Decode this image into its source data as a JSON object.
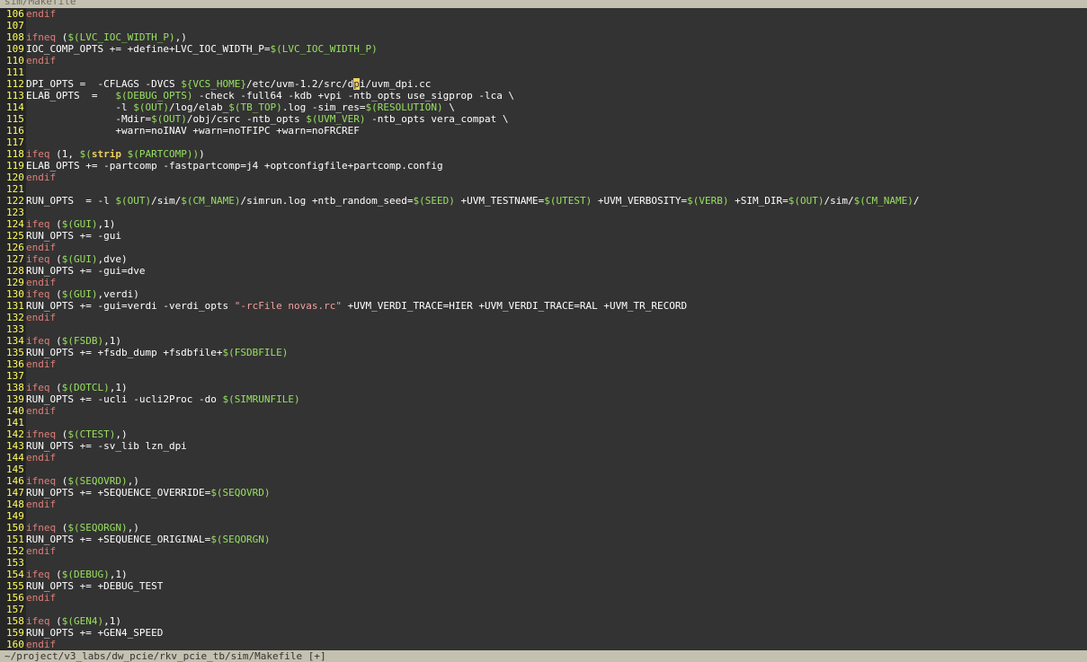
{
  "tab": {
    "label": "sim/Makefile"
  },
  "status": {
    "path": "~/project/v3_labs/dw_pcie/rkv_pcie_tb/sim/Makefile [+]"
  },
  "colors": {
    "background": "#333333",
    "line_number": "#ffff60",
    "keyword": "#e07e78",
    "variable": "#98e060",
    "string": "#f0a0a0",
    "statusline": "#c5c1b0"
  },
  "lines": [
    {
      "n": "106",
      "tokens": [
        {
          "t": "endif",
          "k": "kw"
        }
      ]
    },
    {
      "n": "107",
      "tokens": []
    },
    {
      "n": "108",
      "tokens": [
        {
          "t": "ifneq",
          "k": "kw"
        },
        {
          "t": " (",
          "k": "plain"
        },
        {
          "t": "$(LVC_IOC_WIDTH_P)",
          "k": "var"
        },
        {
          "t": ",)",
          "k": "plain"
        }
      ]
    },
    {
      "n": "109",
      "tokens": [
        {
          "t": "IOC_COMP_OPTS += +define+LVC_IOC_WIDTH_P=",
          "k": "plain"
        },
        {
          "t": "$(LVC_IOC_WIDTH_P)",
          "k": "var"
        }
      ]
    },
    {
      "n": "110",
      "tokens": [
        {
          "t": "endif",
          "k": "kw"
        }
      ]
    },
    {
      "n": "111",
      "tokens": []
    },
    {
      "n": "112",
      "tokens": [
        {
          "t": "DPI_OPTS =  -CFLAGS -DVCS ",
          "k": "plain"
        },
        {
          "t": "${VCS_HOME}",
          "k": "var"
        },
        {
          "t": "/etc/uvm-1.2/src/d",
          "k": "plain"
        },
        {
          "t": "p",
          "k": "cursor"
        },
        {
          "t": "i/uvm_dpi.cc",
          "k": "plain"
        }
      ]
    },
    {
      "n": "113",
      "tokens": [
        {
          "t": "ELAB_OPTS  =   ",
          "k": "plain"
        },
        {
          "t": "$(DEBUG_OPTS)",
          "k": "var"
        },
        {
          "t": " -check -full64 -kdb +vpi -ntb_opts use_sigprop -lca \\",
          "k": "plain"
        }
      ]
    },
    {
      "n": "114",
      "tokens": [
        {
          "t": "               -l ",
          "k": "plain"
        },
        {
          "t": "$(OUT)",
          "k": "var"
        },
        {
          "t": "/log/elab_",
          "k": "plain"
        },
        {
          "t": "$(TB_TOP)",
          "k": "var"
        },
        {
          "t": ".log -sim_res=",
          "k": "plain"
        },
        {
          "t": "$(RESOLUTION)",
          "k": "var"
        },
        {
          "t": " \\",
          "k": "plain"
        }
      ]
    },
    {
      "n": "115",
      "tokens": [
        {
          "t": "               -Mdir=",
          "k": "plain"
        },
        {
          "t": "$(OUT)",
          "k": "var"
        },
        {
          "t": "/obj/csrc -ntb_opts ",
          "k": "plain"
        },
        {
          "t": "$(UVM_VER)",
          "k": "var"
        },
        {
          "t": " -ntb_opts vera_compat \\",
          "k": "plain"
        }
      ]
    },
    {
      "n": "116",
      "tokens": [
        {
          "t": "               +warn=noINAV +warn=noTFIPC +warn=noFRCREF",
          "k": "plain"
        }
      ]
    },
    {
      "n": "117",
      "tokens": []
    },
    {
      "n": "118",
      "tokens": [
        {
          "t": "ifeq",
          "k": "kw"
        },
        {
          "t": " (1, ",
          "k": "plain"
        },
        {
          "t": "$(",
          "k": "var"
        },
        {
          "t": "strip",
          "k": "bold"
        },
        {
          "t": " $(PARTCOMP))",
          "k": "var"
        },
        {
          "t": ")",
          "k": "plain"
        }
      ]
    },
    {
      "n": "119",
      "tokens": [
        {
          "t": "ELAB_OPTS += -partcomp -fastpartcomp=j4 +optconfigfile+partcomp.config",
          "k": "plain"
        }
      ]
    },
    {
      "n": "120",
      "tokens": [
        {
          "t": "endif",
          "k": "kw"
        }
      ]
    },
    {
      "n": "121",
      "tokens": []
    },
    {
      "n": "122",
      "tokens": [
        {
          "t": "RUN_OPTS  = -l ",
          "k": "plain"
        },
        {
          "t": "$(OUT)",
          "k": "var"
        },
        {
          "t": "/sim/",
          "k": "plain"
        },
        {
          "t": "$(CM_NAME)",
          "k": "var"
        },
        {
          "t": "/simrun.log +ntb_random_seed=",
          "k": "plain"
        },
        {
          "t": "$(SEED)",
          "k": "var"
        },
        {
          "t": " +UVM_TESTNAME=",
          "k": "plain"
        },
        {
          "t": "$(UTEST)",
          "k": "var"
        },
        {
          "t": " +UVM_VERBOSITY=",
          "k": "plain"
        },
        {
          "t": "$(VERB)",
          "k": "var"
        },
        {
          "t": " +SIM_DIR=",
          "k": "plain"
        },
        {
          "t": "$(OUT)",
          "k": "var"
        },
        {
          "t": "/sim/",
          "k": "plain"
        },
        {
          "t": "$(CM_NAME)",
          "k": "var"
        },
        {
          "t": "/",
          "k": "plain"
        }
      ]
    },
    {
      "n": "123",
      "tokens": []
    },
    {
      "n": "124",
      "tokens": [
        {
          "t": "ifeq",
          "k": "kw"
        },
        {
          "t": " (",
          "k": "plain"
        },
        {
          "t": "$(GUI)",
          "k": "var"
        },
        {
          "t": ",1)",
          "k": "plain"
        }
      ]
    },
    {
      "n": "125",
      "tokens": [
        {
          "t": "RUN_OPTS += -gui",
          "k": "plain"
        }
      ]
    },
    {
      "n": "126",
      "tokens": [
        {
          "t": "endif",
          "k": "kw"
        }
      ]
    },
    {
      "n": "127",
      "tokens": [
        {
          "t": "ifeq",
          "k": "kw"
        },
        {
          "t": " (",
          "k": "plain"
        },
        {
          "t": "$(GUI)",
          "k": "var"
        },
        {
          "t": ",dve)",
          "k": "plain"
        }
      ]
    },
    {
      "n": "128",
      "tokens": [
        {
          "t": "RUN_OPTS += -gui=dve",
          "k": "plain"
        }
      ]
    },
    {
      "n": "129",
      "tokens": [
        {
          "t": "endif",
          "k": "kw"
        }
      ]
    },
    {
      "n": "130",
      "tokens": [
        {
          "t": "ifeq",
          "k": "kw"
        },
        {
          "t": " (",
          "k": "plain"
        },
        {
          "t": "$(GUI)",
          "k": "var"
        },
        {
          "t": ",verdi)",
          "k": "plain"
        }
      ]
    },
    {
      "n": "131",
      "tokens": [
        {
          "t": "RUN_OPTS += -gui=verdi -verdi_opts ",
          "k": "plain"
        },
        {
          "t": "\"-rcFile novas.rc\"",
          "k": "str"
        },
        {
          "t": " +UVM_VERDI_TRACE=HIER +UVM_VERDI_TRACE=RAL +UVM_TR_RECORD",
          "k": "plain"
        }
      ]
    },
    {
      "n": "132",
      "tokens": [
        {
          "t": "endif",
          "k": "kw"
        }
      ]
    },
    {
      "n": "133",
      "tokens": []
    },
    {
      "n": "134",
      "tokens": [
        {
          "t": "ifeq",
          "k": "kw"
        },
        {
          "t": " (",
          "k": "plain"
        },
        {
          "t": "$(FSDB)",
          "k": "var"
        },
        {
          "t": ",1)",
          "k": "plain"
        }
      ]
    },
    {
      "n": "135",
      "tokens": [
        {
          "t": "RUN_OPTS += +fsdb_dump +fsdbfile+",
          "k": "plain"
        },
        {
          "t": "$(FSDBFILE)",
          "k": "var"
        }
      ]
    },
    {
      "n": "136",
      "tokens": [
        {
          "t": "endif",
          "k": "kw"
        }
      ]
    },
    {
      "n": "137",
      "tokens": []
    },
    {
      "n": "138",
      "tokens": [
        {
          "t": "ifeq",
          "k": "kw"
        },
        {
          "t": " (",
          "k": "plain"
        },
        {
          "t": "$(DOTCL)",
          "k": "var"
        },
        {
          "t": ",1)",
          "k": "plain"
        }
      ]
    },
    {
      "n": "139",
      "tokens": [
        {
          "t": "RUN_OPTS += -ucli -ucli2Proc -do ",
          "k": "plain"
        },
        {
          "t": "$(SIMRUNFILE)",
          "k": "var"
        }
      ]
    },
    {
      "n": "140",
      "tokens": [
        {
          "t": "endif",
          "k": "kw"
        }
      ]
    },
    {
      "n": "141",
      "tokens": []
    },
    {
      "n": "142",
      "tokens": [
        {
          "t": "ifneq",
          "k": "kw"
        },
        {
          "t": " (",
          "k": "plain"
        },
        {
          "t": "$(CTEST)",
          "k": "var"
        },
        {
          "t": ",)",
          "k": "plain"
        }
      ]
    },
    {
      "n": "143",
      "tokens": [
        {
          "t": "RUN_OPTS += -sv_lib lzn_dpi",
          "k": "plain"
        }
      ]
    },
    {
      "n": "144",
      "tokens": [
        {
          "t": "endif",
          "k": "kw"
        }
      ]
    },
    {
      "n": "145",
      "tokens": []
    },
    {
      "n": "146",
      "tokens": [
        {
          "t": "ifneq",
          "k": "kw"
        },
        {
          "t": " (",
          "k": "plain"
        },
        {
          "t": "$(SEQOVRD)",
          "k": "var"
        },
        {
          "t": ",)",
          "k": "plain"
        }
      ]
    },
    {
      "n": "147",
      "tokens": [
        {
          "t": "RUN_OPTS += +SEQUENCE_OVERRIDE=",
          "k": "plain"
        },
        {
          "t": "$(SEQOVRD)",
          "k": "var"
        }
      ]
    },
    {
      "n": "148",
      "tokens": [
        {
          "t": "endif",
          "k": "kw"
        }
      ]
    },
    {
      "n": "149",
      "tokens": []
    },
    {
      "n": "150",
      "tokens": [
        {
          "t": "ifneq",
          "k": "kw"
        },
        {
          "t": " (",
          "k": "plain"
        },
        {
          "t": "$(SEQORGN)",
          "k": "var"
        },
        {
          "t": ",)",
          "k": "plain"
        }
      ]
    },
    {
      "n": "151",
      "tokens": [
        {
          "t": "RUN_OPTS += +SEQUENCE_ORIGINAL=",
          "k": "plain"
        },
        {
          "t": "$(SEQORGN)",
          "k": "var"
        }
      ]
    },
    {
      "n": "152",
      "tokens": [
        {
          "t": "endif",
          "k": "kw"
        }
      ]
    },
    {
      "n": "153",
      "tokens": []
    },
    {
      "n": "154",
      "tokens": [
        {
          "t": "ifeq",
          "k": "kw"
        },
        {
          "t": " (",
          "k": "plain"
        },
        {
          "t": "$(DEBUG)",
          "k": "var"
        },
        {
          "t": ",1)",
          "k": "plain"
        }
      ]
    },
    {
      "n": "155",
      "tokens": [
        {
          "t": "RUN_OPTS += +DEBUG_TEST",
          "k": "plain"
        }
      ]
    },
    {
      "n": "156",
      "tokens": [
        {
          "t": "endif",
          "k": "kw"
        }
      ]
    },
    {
      "n": "157",
      "tokens": []
    },
    {
      "n": "158",
      "tokens": [
        {
          "t": "ifeq",
          "k": "kw"
        },
        {
          "t": " (",
          "k": "plain"
        },
        {
          "t": "$(GEN4)",
          "k": "var"
        },
        {
          "t": ",1)",
          "k": "plain"
        }
      ]
    },
    {
      "n": "159",
      "tokens": [
        {
          "t": "RUN_OPTS += +GEN4_SPEED",
          "k": "plain"
        }
      ]
    },
    {
      "n": "160",
      "tokens": [
        {
          "t": "endif",
          "k": "kw"
        }
      ]
    }
  ]
}
